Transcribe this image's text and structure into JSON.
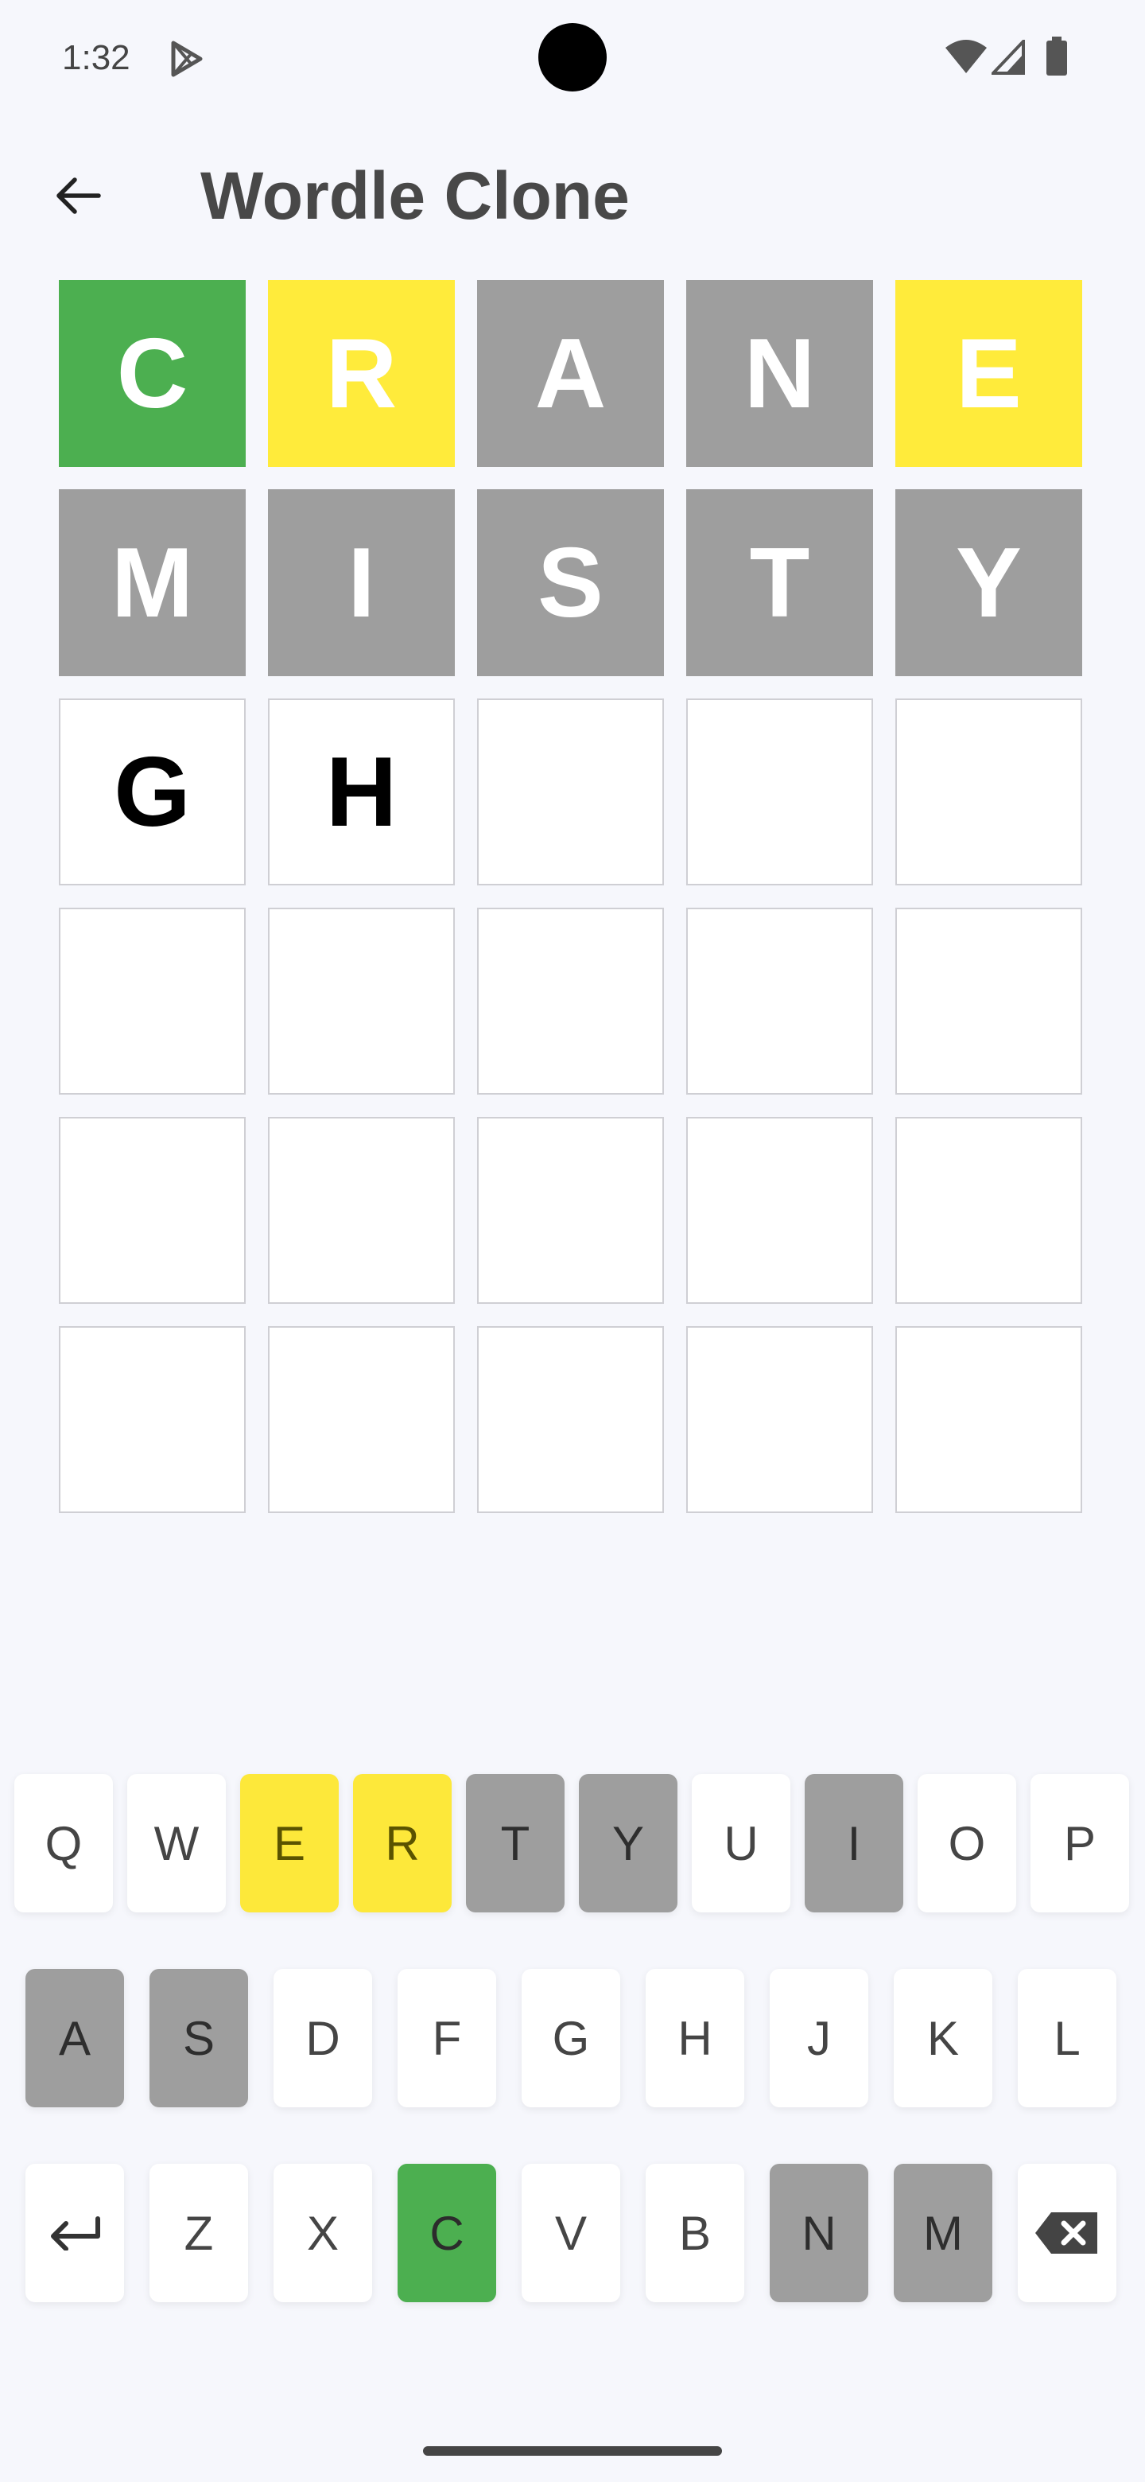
{
  "status_bar": {
    "time": "1:32"
  },
  "app_bar": {
    "title": "Wordle Clone"
  },
  "board": {
    "rows": [
      [
        {
          "letter": "C",
          "state": "correct"
        },
        {
          "letter": "R",
          "state": "present"
        },
        {
          "letter": "A",
          "state": "absent"
        },
        {
          "letter": "N",
          "state": "absent"
        },
        {
          "letter": "E",
          "state": "present"
        }
      ],
      [
        {
          "letter": "M",
          "state": "absent"
        },
        {
          "letter": "I",
          "state": "absent"
        },
        {
          "letter": "S",
          "state": "absent"
        },
        {
          "letter": "T",
          "state": "absent"
        },
        {
          "letter": "Y",
          "state": "absent"
        }
      ],
      [
        {
          "letter": "G",
          "state": "empty"
        },
        {
          "letter": "H",
          "state": "empty"
        },
        {
          "letter": "",
          "state": "empty"
        },
        {
          "letter": "",
          "state": "empty"
        },
        {
          "letter": "",
          "state": "empty"
        }
      ],
      [
        {
          "letter": "",
          "state": "empty"
        },
        {
          "letter": "",
          "state": "empty"
        },
        {
          "letter": "",
          "state": "empty"
        },
        {
          "letter": "",
          "state": "empty"
        },
        {
          "letter": "",
          "state": "empty"
        }
      ],
      [
        {
          "letter": "",
          "state": "empty"
        },
        {
          "letter": "",
          "state": "empty"
        },
        {
          "letter": "",
          "state": "empty"
        },
        {
          "letter": "",
          "state": "empty"
        },
        {
          "letter": "",
          "state": "empty"
        }
      ],
      [
        {
          "letter": "",
          "state": "empty"
        },
        {
          "letter": "",
          "state": "empty"
        },
        {
          "letter": "",
          "state": "empty"
        },
        {
          "letter": "",
          "state": "empty"
        },
        {
          "letter": "",
          "state": "empty"
        }
      ]
    ]
  },
  "keyboard": {
    "rows": [
      [
        {
          "label": "Q",
          "state": "default"
        },
        {
          "label": "W",
          "state": "default"
        },
        {
          "label": "E",
          "state": "present"
        },
        {
          "label": "R",
          "state": "present"
        },
        {
          "label": "T",
          "state": "absent"
        },
        {
          "label": "Y",
          "state": "absent"
        },
        {
          "label": "U",
          "state": "default"
        },
        {
          "label": "I",
          "state": "absent"
        },
        {
          "label": "O",
          "state": "default"
        },
        {
          "label": "P",
          "state": "default"
        }
      ],
      [
        {
          "label": "A",
          "state": "absent"
        },
        {
          "label": "S",
          "state": "absent"
        },
        {
          "label": "D",
          "state": "default"
        },
        {
          "label": "F",
          "state": "default"
        },
        {
          "label": "G",
          "state": "default"
        },
        {
          "label": "H",
          "state": "default"
        },
        {
          "label": "J",
          "state": "default"
        },
        {
          "label": "K",
          "state": "default"
        },
        {
          "label": "L",
          "state": "default"
        }
      ],
      [
        {
          "label": "",
          "icon": "enter-icon",
          "state": "default"
        },
        {
          "label": "Z",
          "state": "default"
        },
        {
          "label": "X",
          "state": "default"
        },
        {
          "label": "C",
          "state": "correct"
        },
        {
          "label": "V",
          "state": "default"
        },
        {
          "label": "B",
          "state": "default"
        },
        {
          "label": "N",
          "state": "absent"
        },
        {
          "label": "M",
          "state": "absent"
        },
        {
          "label": "",
          "icon": "backspace-icon",
          "state": "default"
        }
      ]
    ]
  },
  "colors": {
    "correct": "#4caf50",
    "present": "#ffeb3b",
    "absent": "#9e9e9e",
    "background": "#f6f7fc"
  },
  "icons": {
    "status": [
      "play-store-icon",
      "wifi-icon",
      "signal-icon",
      "battery-icon"
    ],
    "app_bar": [
      "back-arrow-icon"
    ]
  }
}
